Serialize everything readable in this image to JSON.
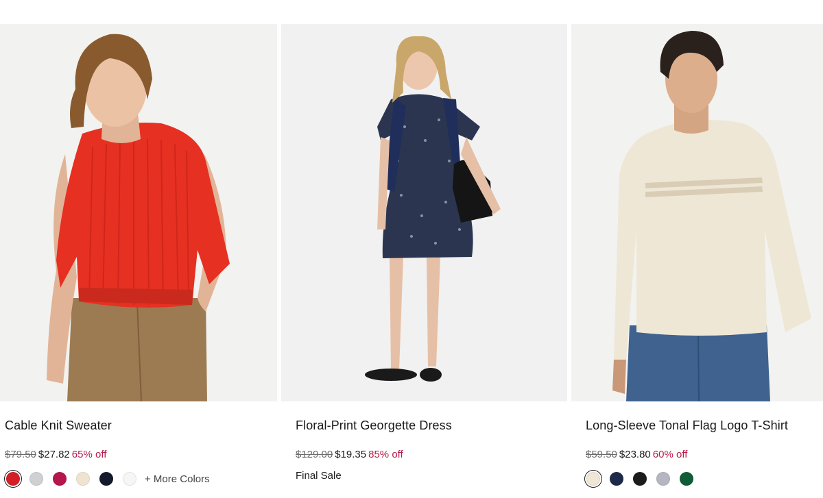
{
  "products": [
    {
      "name": "Cable Knit Sweater",
      "original_price": "$79.50",
      "sale_price": "$27.82",
      "discount": "65% off",
      "swatches": [
        "#d41f26",
        "#cfd0d2",
        "#b5164d",
        "#efe4d2",
        "#141a2c",
        "#f6f6f6"
      ],
      "more_colors": "+ More Colors"
    },
    {
      "name": "Floral-Print Georgette Dress",
      "original_price": "$129.00",
      "sale_price": "$19.35",
      "discount": "85% off",
      "final_sale": "Final Sale"
    },
    {
      "name": "Long-Sleeve Tonal Flag Logo T-Shirt",
      "original_price": "$59.50",
      "sale_price": "$23.80",
      "discount": "60% off",
      "swatches": [
        "#efe6d5",
        "#1d2a4a",
        "#1c1c1e",
        "#b4b6c0",
        "#0f5c37"
      ]
    }
  ],
  "colors": {
    "discount": "#b71c4a",
    "text": "#1a1a1a",
    "strikethrough": "#6b6b6b"
  }
}
